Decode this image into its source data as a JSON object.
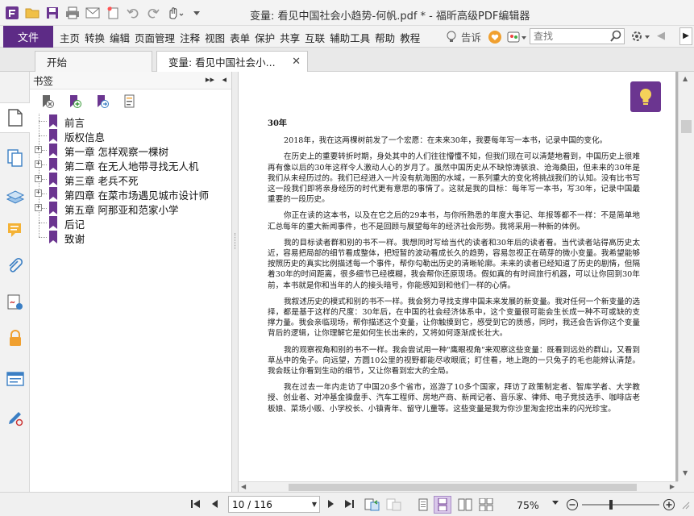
{
  "window": {
    "title": "变量: 看见中国社会小趋势-何帆.pdf * - 福昕高级PDF编辑器"
  },
  "ribbon": {
    "file_label": "文件",
    "tabs": [
      "主页",
      "转换",
      "编辑",
      "页面管理",
      "注释",
      "视图",
      "表单",
      "保护",
      "共享",
      "互联",
      "辅助工具",
      "帮助",
      "教程"
    ],
    "tell_label": "告诉",
    "search_placeholder": "查找"
  },
  "doc_tabs": [
    {
      "label": "开始"
    },
    {
      "label": "变量: 看见中国社会小...",
      "close": "✕"
    }
  ],
  "bookmarks": {
    "header": "书签",
    "items": [
      {
        "label": "前言",
        "expandable": false
      },
      {
        "label": "版权信息",
        "expandable": false
      },
      {
        "label": "第一章 怎样观察一棵树",
        "expandable": true
      },
      {
        "label": "第二章 在无人地带寻找无人机",
        "expandable": true
      },
      {
        "label": "第三章 老兵不死",
        "expandable": true
      },
      {
        "label": "第四章 在菜市场遇见城市设计师",
        "expandable": true
      },
      {
        "label": "第五章 阿那亚和范家小学",
        "expandable": true
      },
      {
        "label": "后记",
        "expandable": false
      },
      {
        "label": "致谢",
        "expandable": false
      }
    ],
    "expand_glyph": "+"
  },
  "page": {
    "heading": "30年",
    "paragraphs": [
      "2018年，我在这两棵树前发了一个宏愿：在未来30年，我要每年写一本书，记录中国的变化。",
      "在历史上的重要转折时期，身处其中的人们往往懵懂不知，但我们现在可以清楚地看到，中国历史上很难再有像以后的30年这样令人激动人心的岁月了。虽然中国历史从不缺惊涛骇浪、沧海桑田，但未来的30年是我们从未经历过的。我们已经进入一片没有航海图的水域，一系列重大的变化将挑战我们的认知。没有比书写这一段我们即将亲身经历的时代更有意思的事情了。这就是我的目标：每年写一本书，写30年，记录中国最重要的一段历史。",
      "你正在读的这本书，以及在它之后的29本书，与你所熟悉的年度大事记、年报等都不一样：不是简单地汇总每年的重大新闻事件，也不是回顾与展望每年的经济社会形势。我将采用一种新的体例。",
      "我的目标读者群和别的书不一样。我想同时写给当代的读者和30年后的读者看。当代读者站得高历史太近，容易把局部的细节看成整体，把短暂的波动看成长久的趋势，容易忽视正在萌芽的微小变量。我希望能够按照历史的真实比例描述每一个事件，帮你勾勒出历史的清晰轮廓。未来的读者已经知道了历史的剧情，但隔着30年的时间距离，很多细节已经模糊，我会帮你还原现场。假如真的有时间旅行机器，可以让你回到30年前，本书就是你和当年的人的接头暗号，你能感知到和他们一样的心情。",
      "我叙述历史的模式和别的书不一样。我会努力寻找支撑中国未来发展的新变量。我对任何一个新变量的选择，都是基于这样的尺度：30年后，在中国的社会经济体系中，这个变量很可能会生长成一种不可或缺的支撑力量。我会亲临现场，帮你描述这个变量，让你触摸到它，感受到它的质感，同时，我还会告诉你这个变量背后的逻辑，让你理解它是如何生长出来的，又将如何逐渐成长壮大。",
      "我的观察视角和别的书不一样。我会尝试用一种\"鹰眼视角\"来观察这些变量：既看到远处的群山，又看到草丛中的兔子。向远望，方圆10公里的视野都能尽收眼底；盯住看，地上跑的一只兔子的毛也能辨认清楚。我会既让你看到生动的细节，又让你看到宏大的全局。",
      "我在过去一年内走访了中国20多个省市，巡游了10多个国家，拜访了政策制定者、智库学者、大学教授、创业者、对冲基金操盘手、汽车工程师、房地产商、新闻记者、音乐家、律师、电子竞技选手、咖啡店老板娘、菜场小贩、小学校长、小镇青年、留守儿童等。这些变量是我为你沙里淘金挖出来的闪光珍宝。"
    ]
  },
  "status": {
    "page_value": "10 / 116",
    "zoom": "75%",
    "zoom_fraction": 0.75
  },
  "colors": {
    "accent": "#5d2b86",
    "bookmark_flag": "#6b3590"
  }
}
